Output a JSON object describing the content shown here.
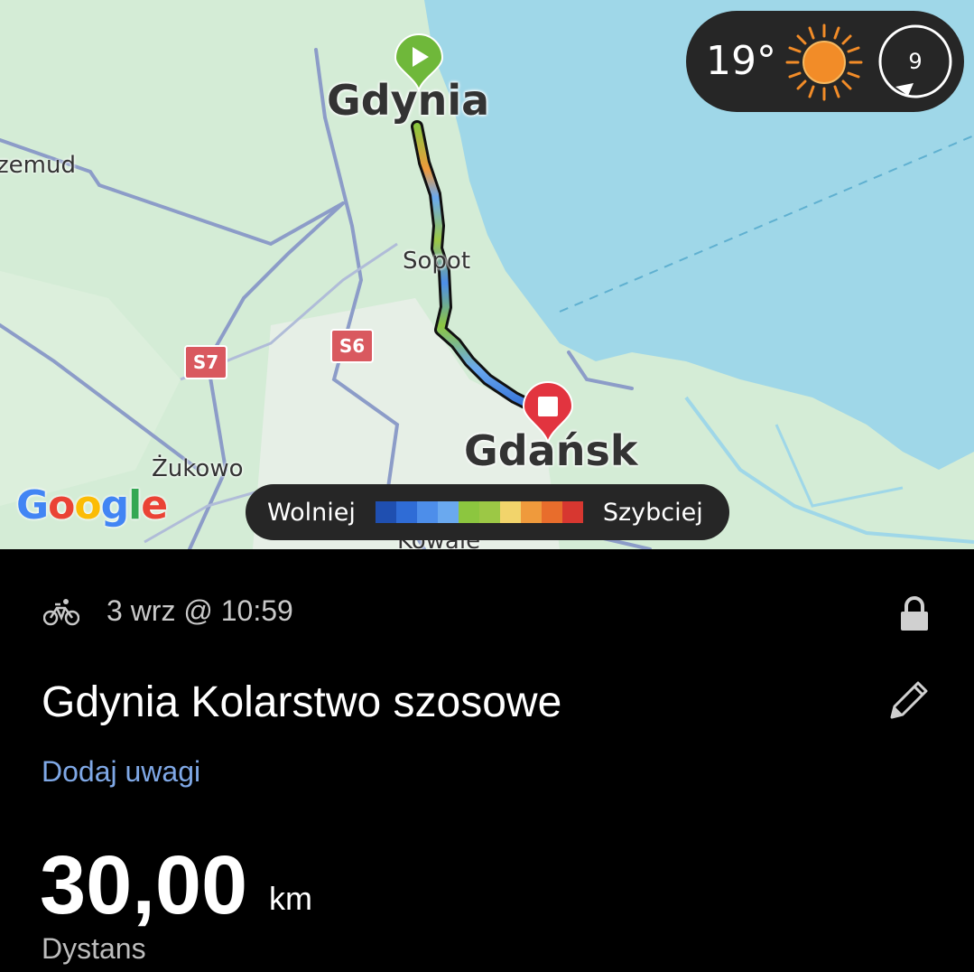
{
  "map": {
    "cities": {
      "gdynia": "Gdynia",
      "gdansk": "Gdańsk",
      "sopot": "Sopot",
      "zukowo": "Żukowo",
      "zemud": "zemud",
      "kowale": "Kowale"
    },
    "road_badges": [
      "S7",
      "S6"
    ],
    "attribution": {
      "letters": [
        "G",
        "o",
        "o",
        "g",
        "l",
        "e"
      ],
      "colors": [
        "#4285F4",
        "#EA4335",
        "#FBBC05",
        "#4285F4",
        "#34A853",
        "#EA4335"
      ]
    },
    "start_pin_icon": "play-icon",
    "end_pin_icon": "stop-icon",
    "colors": {
      "land": "#d4ecd6",
      "water": "#9fd7e8",
      "start_pin": "#6fb83a",
      "end_pin": "#e2343f",
      "road_badge": "#d9595f"
    }
  },
  "weather": {
    "temperature": "19°",
    "condition_icon": "sun-icon",
    "wind_value": "9",
    "wind_icon": "wind-direction-icon"
  },
  "speed_legend": {
    "slower_label": "Wolniej",
    "faster_label": "Szybciej",
    "colors": [
      "#1f4fb0",
      "#2f6cd6",
      "#4d8eea",
      "#6aa9ef",
      "#8cc63f",
      "#9cc845",
      "#f2d46b",
      "#ef9a3c",
      "#e86d2c",
      "#d73730"
    ]
  },
  "activity": {
    "sport_icon": "bicycle-icon",
    "date": "3 wrz @ 10:59",
    "privacy_icon": "lock-icon",
    "title": "Gdynia Kolarstwo szosowe",
    "edit_icon": "pencil-icon",
    "notes_link": "Dodaj uwagi",
    "distance_value": "30,00",
    "distance_unit": "km",
    "distance_label": "Dystans"
  }
}
